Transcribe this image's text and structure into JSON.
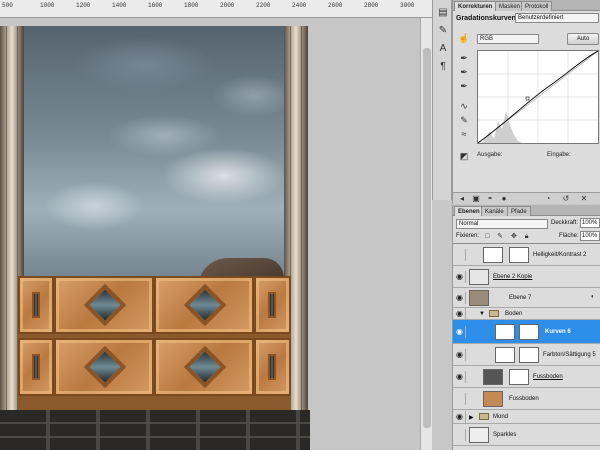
{
  "ruler": {
    "ticks": [
      "500",
      "1000",
      "1200",
      "1400",
      "1600",
      "1800",
      "2000",
      "2200",
      "2400",
      "2600",
      "2800",
      "3000"
    ]
  },
  "adjustments": {
    "tabs": [
      "Korrekturen",
      "Masken",
      "Protokoll"
    ],
    "title": "Gradationskurven",
    "preset": "Benutzerdefiniert",
    "channel": "RGB",
    "auto_label": "Auto",
    "output_label": "Ausgabe:",
    "input_label": "Eingabe:"
  },
  "layers": {
    "tabs": [
      "Ebenen",
      "Kanäle",
      "Pfade"
    ],
    "blend_mode": "Normal",
    "opacity_label": "Deckkraft:",
    "opacity_value": "100%",
    "lock_label": "Fixieren:",
    "fill_label": "Fläche:",
    "fill_value": "100%",
    "items": [
      {
        "name": "Helligkeit/Kontrast 2",
        "selected": false
      },
      {
        "name": "Ebene 2 Kopie",
        "selected": false
      },
      {
        "name": "Ebene 7",
        "selected": false
      },
      {
        "name": "Boden",
        "selected": false
      },
      {
        "name": "Kurven 6",
        "selected": true
      },
      {
        "name": "Farbton/Sättigung 5",
        "selected": false
      },
      {
        "name": "Fussboden",
        "selected": false
      },
      {
        "name": "Fussboden",
        "selected": false
      },
      {
        "name": "Mond",
        "selected": false
      },
      {
        "name": "Sparkles",
        "selected": false
      }
    ]
  },
  "colors": {
    "selection": "#2c8ee8",
    "panel_bg": "#dcdcdc"
  },
  "icons": [
    "eye-icon",
    "folder-icon",
    "lock-icon",
    "curve-tool-icon",
    "eyedropper-icon",
    "link-icon",
    "trash-icon"
  ]
}
